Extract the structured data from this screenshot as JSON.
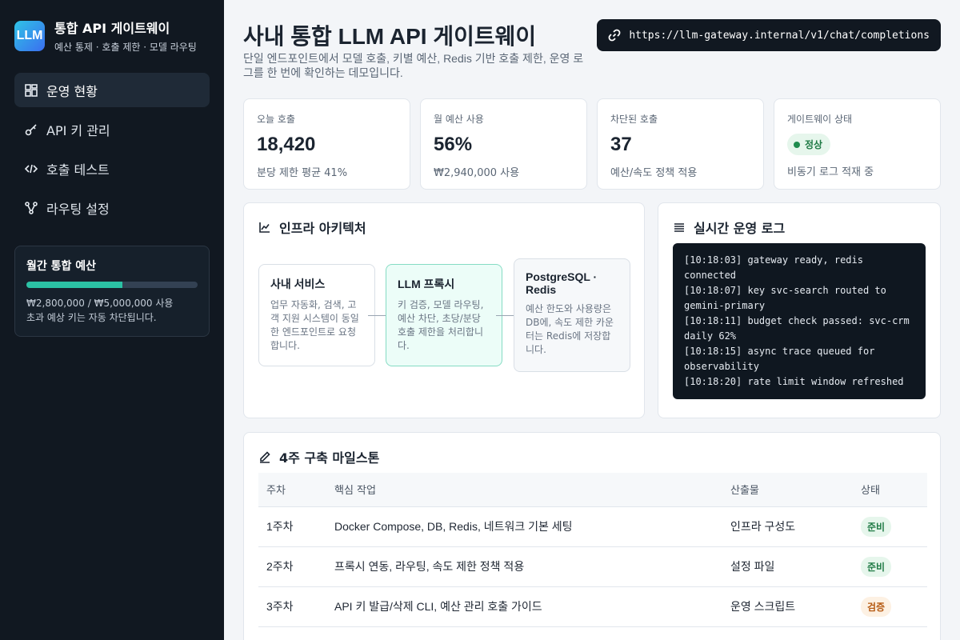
{
  "sidebar": {
    "logo": "LLM",
    "title": "통합 API 게이트웨이",
    "subtitle": "예산 통제 · 호출 제한 · 모델 라우팅",
    "nav": [
      {
        "label": "운영 현황",
        "icon": "dashboard-icon",
        "active": true
      },
      {
        "label": "API 키 관리",
        "icon": "key-icon",
        "active": false
      },
      {
        "label": "호출 테스트",
        "icon": "code-icon",
        "active": false
      },
      {
        "label": "라우팅 설정",
        "icon": "routing-icon",
        "active": false
      }
    ],
    "budget": {
      "title": "월간 통합 예산",
      "used_fraction": 0.56,
      "amount_text": "₩2,800,000 / ₩5,000,000 사용",
      "note": "초과 예상 키는 자동 차단됩니다."
    }
  },
  "header": {
    "title": "사내 통합 LLM API 게이트웨이",
    "description": "단일 엔드포인트에서 모델 호출, 키별 예산, Redis 기반 호출 제한, 운영 로그를 한 번에 확인하는 데모입니다.",
    "endpoint": "https://llm-gateway.internal/v1/chat/completions"
  },
  "cards": [
    {
      "label": "오늘 호출",
      "value": "18,420",
      "sub": "분당 제한 평균 41%"
    },
    {
      "label": "월 예산 사용",
      "value": "56%",
      "sub": "₩2,940,000 사용"
    },
    {
      "label": "차단된 호출",
      "value": "37",
      "sub": "예산/속도 정책 적용"
    },
    {
      "label": "게이트웨이 상태",
      "status": "정상",
      "sub": "비동기 로그 적재 중"
    }
  ],
  "architecture": {
    "title": "인프라 아키텍처",
    "nodes": [
      {
        "title": "사내 서비스",
        "desc": "업무 자동화, 검색, 고객 지원 시스템이 동일한 엔드포인트로 요청합니다."
      },
      {
        "title": "LLM 프록시",
        "desc": "키 검증, 모델 라우팅, 예산 차단, 초당/분당 호출 제한을 처리합니다."
      },
      {
        "title": "PostgreSQL · Redis",
        "desc": "예산 한도와 사용량은 DB에, 속도 제한 카운터는 Redis에 저장합니다."
      }
    ]
  },
  "logs": {
    "title": "실시간 운영 로그",
    "lines": [
      "[10:18:03] gateway ready, redis connected",
      "[10:18:07] key svc-search routed to gemini-primary",
      "[10:18:11] budget check passed: svc-crm daily 62%",
      "[10:18:15] async trace queued for observability",
      "[10:18:20] rate limit window refreshed"
    ]
  },
  "milestones": {
    "title": "4주 구축 마일스톤",
    "columns": [
      "주차",
      "핵심 작업",
      "산출물",
      "상태"
    ],
    "rows": [
      {
        "week": "1주차",
        "task": "Docker Compose, DB, Redis, 네트워크 기본 세팅",
        "output": "인프라 구성도",
        "status": "준비",
        "status_kind": "ready"
      },
      {
        "week": "2주차",
        "task": "프록시 연동, 라우팅, 속도 제한 정책 적용",
        "output": "설정 파일",
        "status": "준비",
        "status_kind": "ready"
      },
      {
        "week": "3주차",
        "task": "API 키 발급/삭제 CLI, 예산 관리 호출 가이드",
        "output": "운영 스크립트",
        "status": "검증",
        "status_kind": "verify"
      }
    ]
  }
}
